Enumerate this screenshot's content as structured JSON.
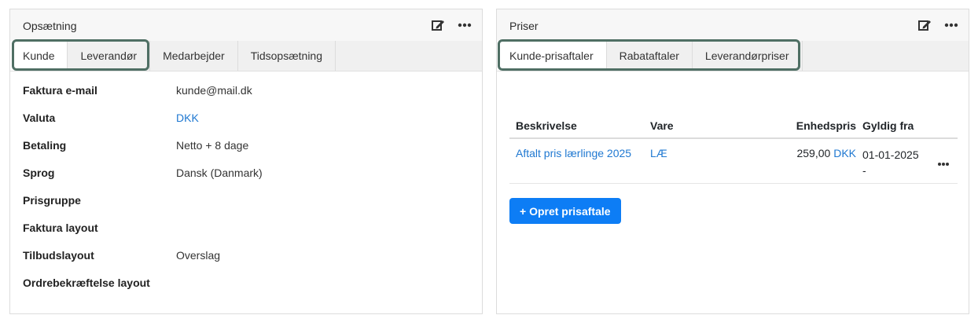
{
  "left": {
    "title": "Opsætning",
    "tabs": [
      "Kunde",
      "Leverandør",
      "Medarbejder",
      "Tidsopsætning"
    ],
    "rows": [
      {
        "label": "Faktura e-mail",
        "value": "kunde@mail.dk"
      },
      {
        "label": "Valuta",
        "value": "DKK"
      },
      {
        "label": "Betaling",
        "value": "Netto + 8 dage"
      },
      {
        "label": "Sprog",
        "value": "Dansk (Danmark)"
      },
      {
        "label": "Prisgruppe",
        "value": ""
      },
      {
        "label": "Faktura layout",
        "value": ""
      },
      {
        "label": "Tilbudslayout",
        "value": "Overslag"
      },
      {
        "label": "Ordrebekræftelse layout",
        "value": ""
      }
    ]
  },
  "right": {
    "title": "Priser",
    "tabs": [
      "Kunde-prisaftaler",
      "Rabataftaler",
      "Leverandørpriser"
    ],
    "table": {
      "headers": [
        "Beskrivelse",
        "Vare",
        "Enhedspris",
        "Gyldig fra"
      ],
      "rows": [
        {
          "description": "Aftalt pris lærlinge 2025",
          "item": "LÆ",
          "price": "259,00",
          "currency": "DKK",
          "valid_from": "01-01-2025",
          "valid_to": "-"
        }
      ]
    },
    "create_button": "+ Opret prisaftale"
  },
  "colors": {
    "accent": "#1f78d1",
    "button": "#0d7df5",
    "highlight": "#4f6f64"
  }
}
